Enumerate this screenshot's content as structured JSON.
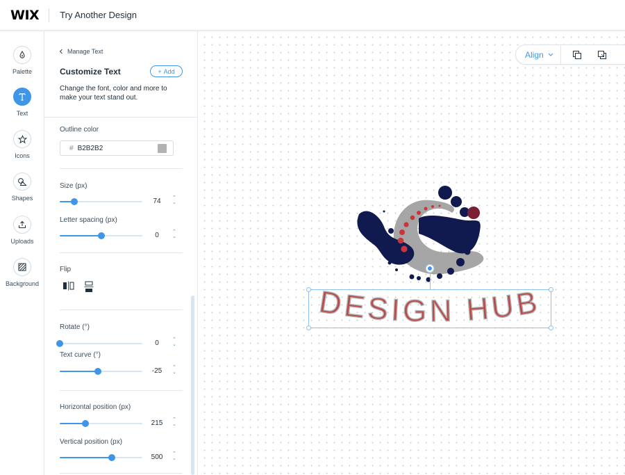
{
  "app": {
    "logo": "WIX",
    "title": "Try Another Design"
  },
  "rail": [
    {
      "label": "Palette",
      "icon": "palette-icon"
    },
    {
      "label": "Text",
      "icon": "text-icon",
      "active": true
    },
    {
      "label": "Icons",
      "icon": "star-icon"
    },
    {
      "label": "Shapes",
      "icon": "shapes-icon"
    },
    {
      "label": "Uploads",
      "icon": "upload-icon"
    },
    {
      "label": "Background",
      "icon": "background-icon"
    }
  ],
  "panel": {
    "back_label": "Manage Text",
    "title": "Customize Text",
    "add_label": "Add",
    "description": "Change the font, color and more to make your text stand out.",
    "outline_color_label": "Outline color",
    "outline_color_hash": "#",
    "outline_color_value": "B2B2B2",
    "outline_color_hex": "#b2b2b2",
    "size_label": "Size (px)",
    "size_value": "74",
    "size_fraction": 0.18,
    "letter_spacing_label": "Letter spacing (px)",
    "letter_spacing_value": "0",
    "letter_spacing_fraction": 0.5,
    "flip_label": "Flip",
    "rotate_label": "Rotate (°)",
    "rotate_value": "0",
    "rotate_fraction": 0.0,
    "text_curve_label": "Text curve (°)",
    "text_curve_value": "-25",
    "text_curve_fraction": 0.46,
    "hpos_label": "Horizontal position (px)",
    "hpos_value": "215",
    "hpos_fraction": 0.31,
    "vpos_label": "Vertical position (px)",
    "vpos_value": "500",
    "vpos_fraction": 0.63
  },
  "toolbar": {
    "align_label": "Align"
  },
  "canvas": {
    "text": "DESIGN HUB",
    "text_color": "#b84a4a",
    "text_outline": "#b2b2b2",
    "navy": "#111a4e",
    "gray": "#a6a6a6",
    "red": "#c8363b"
  },
  "colors": {
    "accent": "#3f96e8"
  }
}
